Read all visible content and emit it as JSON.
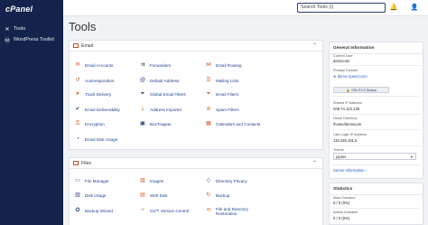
{
  "sidebar": {
    "logo": "cPanel",
    "items": [
      {
        "label": "Tools",
        "icon": "wrench-icon"
      },
      {
        "label": "WordPress Toolkit",
        "icon": "wordpress-icon"
      }
    ]
  },
  "header": {
    "search_placeholder": "Search Tools (/)",
    "icons": [
      "notifications-icon",
      "user-icon"
    ]
  },
  "page": {
    "title": "Tools"
  },
  "email": {
    "title": "Email",
    "tools": [
      {
        "label": "Email Accounts",
        "icon": "mail-icon"
      },
      {
        "label": "Forwarders",
        "icon": "forward-icon"
      },
      {
        "label": "Email Routing",
        "icon": "routing-icon"
      },
      {
        "label": "Autoresponders",
        "icon": "autoresponder-icon"
      },
      {
        "label": "Default Address",
        "icon": "at-sign-icon"
      },
      {
        "label": "Mailing Lists",
        "icon": "mailing-list-icon"
      },
      {
        "label": "Track Delivery",
        "icon": "track-icon"
      },
      {
        "label": "Global Email Filters",
        "icon": "filter-icon"
      },
      {
        "label": "Email Filters",
        "icon": "filter-icon"
      },
      {
        "label": "Email Deliverability",
        "icon": "deliverability-icon"
      },
      {
        "label": "Address Importer",
        "icon": "importer-icon"
      },
      {
        "label": "Spam Filters",
        "icon": "spam-icon"
      },
      {
        "label": "Encryption",
        "icon": "key-icon"
      },
      {
        "label": "BoxTrapper",
        "icon": "boxtrapper-icon"
      },
      {
        "label": "Calendars and Contacts",
        "icon": "calendar-icon"
      },
      {
        "label": "Email Disk Usage",
        "icon": "disk-usage-icon"
      }
    ]
  },
  "files": {
    "title": "Files",
    "tools": [
      {
        "label": "File Manager",
        "icon": "folder-icon"
      },
      {
        "label": "Images",
        "icon": "image-icon"
      },
      {
        "label": "Directory Privacy",
        "icon": "privacy-icon"
      },
      {
        "label": "Disk Usage",
        "icon": "disk-icon"
      },
      {
        "label": "Web Disk",
        "icon": "web-disk-icon"
      },
      {
        "label": "Backup",
        "icon": "backup-icon"
      },
      {
        "label": "Backup Wizard",
        "icon": "wizard-icon"
      },
      {
        "label": "Git™ Version Control",
        "icon": "git-icon"
      },
      {
        "label": "File and Directory Restoration",
        "icon": "restore-icon"
      }
    ]
  },
  "general_info": {
    "title": "General Information",
    "current_user_label": "Current User",
    "current_user": "democom",
    "primary_domain_label": "Primary Domain",
    "primary_domain": "demo.cpanel.com",
    "ssl_button": "SSL/TLS Status",
    "shared_ip_label": "Shared IP Address",
    "shared_ip": "208.74.122.135",
    "home_dir_label": "Home Directory",
    "home_dir": "/home/democom",
    "last_login_label": "Last Login IP Address",
    "last_login": "118.226.151.5",
    "theme_label": "Theme",
    "theme_value": "jupiter",
    "server_info": "Server Information"
  },
  "stats": {
    "title": "Statistics",
    "items": [
      {
        "label": "Alias Domains",
        "value": "0 / 0 (0%)"
      },
      {
        "label": "Addon Domains",
        "value": "0 / 0 (0%)"
      }
    ]
  },
  "colors": {
    "sidebar": "#14234b",
    "accent_orange": "#d35b2a",
    "link_blue": "#1f3f8f"
  }
}
